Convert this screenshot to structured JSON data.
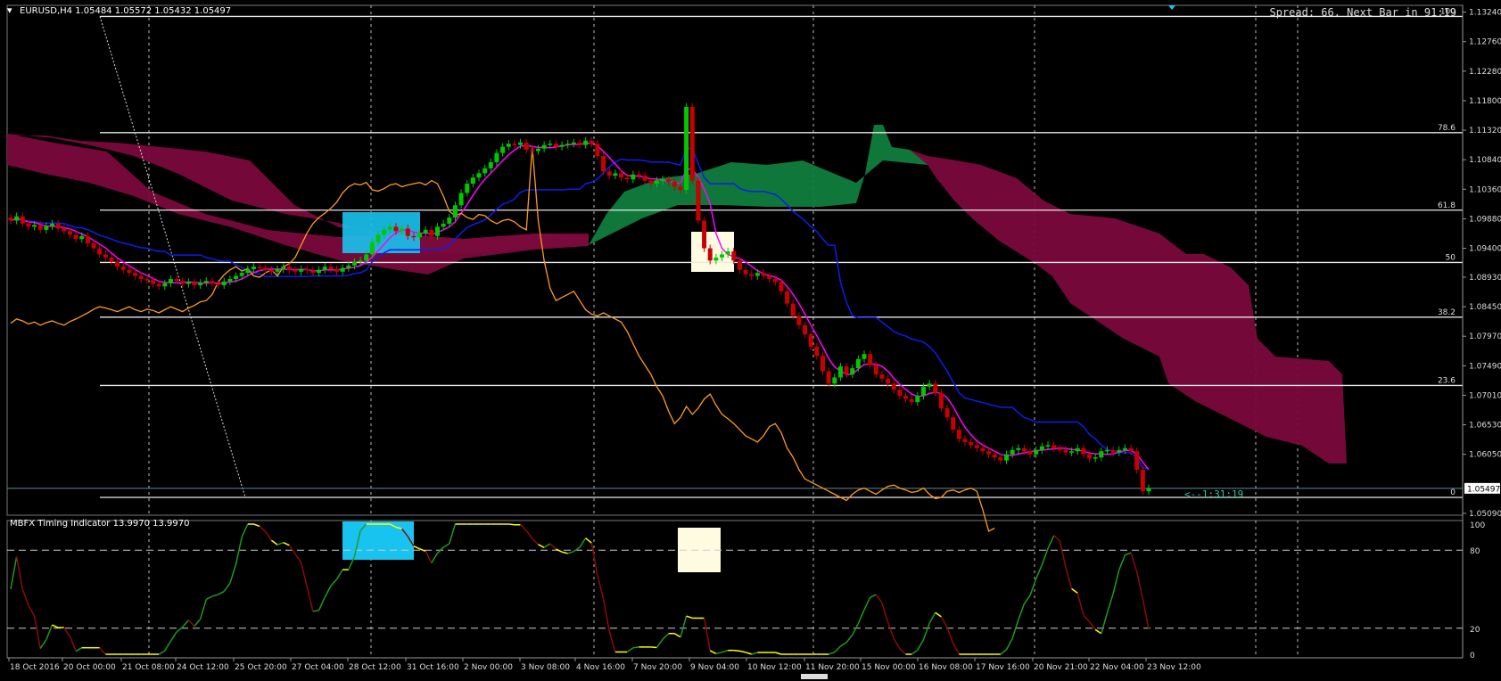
{
  "header": {
    "symbol_line": "EURUSD,H4  1.05484 1.05572 1.05432 1.05497",
    "spread_text": "Spread: 66. Next Bar in 91:19"
  },
  "indicator": {
    "title": "MBFX Timing Indicator 13.9970 13.9970",
    "levels": [
      "100",
      "80",
      "20",
      "0"
    ]
  },
  "countdown": "<--1:31:19",
  "colors": {
    "background": "#000000",
    "bull_candle": "#00c800",
    "bear_candle": "#c80000",
    "blue_line": "#0a1ef0",
    "magenta_line": "#ff00ff",
    "orange_line": "#ff9a1e",
    "cloud_bear": "#7a0a3c",
    "cloud_bull": "#0f7d3c",
    "cyan_box": "#19c3f0",
    "cream_box": "#fffbe1",
    "bid_line": "#5a8c96"
  },
  "chart_data": {
    "type": "candlestick",
    "symbol": "EURUSD",
    "timeframe": "H4",
    "ohlc_last": {
      "open": 1.05484,
      "high": 1.05572,
      "low": 1.05432,
      "close": 1.05497
    },
    "current_price": "1.05497",
    "y_tick_labels": [
      "1.13240",
      "1.12760",
      "1.12280",
      "1.11800",
      "1.11320",
      "1.10840",
      "1.10360",
      "1.09880",
      "1.09400",
      "1.08930",
      "1.08450",
      "1.07970",
      "1.07490",
      "1.07010",
      "1.06530",
      "1.06050",
      "1.05090"
    ],
    "y_tick_values": [
      1.1324,
      1.1276,
      1.1228,
      1.118,
      1.1132,
      1.1084,
      1.1036,
      1.0988,
      1.094,
      1.0893,
      1.0845,
      1.0797,
      1.0749,
      1.0701,
      1.0653,
      1.0605,
      1.0509
    ],
    "ylim": [
      1.0506,
      1.1335
    ],
    "x_tick_labels": [
      "18 Oct 2016",
      "20 Oct 00:00",
      "21 Oct 08:00",
      "24 Oct 12:00",
      "25 Oct 20:00",
      "27 Oct 04:00",
      "28 Oct 12:00",
      "31 Oct 16:00",
      "2 Nov 00:00",
      "3 Nov 08:00",
      "4 Nov 16:00",
      "7 Nov 20:00",
      "9 Nov 04:00",
      "10 Nov 12:00",
      "11 Nov 20:00",
      "15 Nov 00:00",
      "16 Nov 08:00",
      "17 Nov 16:00",
      "20 Nov 21:00",
      "22 Nov 04:00",
      "23 Nov 12:00"
    ],
    "fib_levels": [
      {
        "label": "100",
        "price": 1.1317
      },
      {
        "label": "78.6",
        "price": 1.1128
      },
      {
        "label": "61.8",
        "price": 1.1002
      },
      {
        "label": "50",
        "price": 1.0917
      },
      {
        "label": "38.2",
        "price": 1.0828
      },
      {
        "label": "23.6",
        "price": 1.0717
      },
      {
        "label": "0",
        "price": 1.0535
      }
    ],
    "candles_close": [
      1.0985,
      1.0992,
      1.098,
      1.0975,
      1.0978,
      1.097,
      1.0976,
      1.098,
      1.0972,
      1.0968,
      1.0962,
      1.0955,
      1.096,
      1.0948,
      1.094,
      1.093,
      1.0925,
      1.0918,
      1.091,
      1.0905,
      1.09,
      1.0895,
      1.089,
      1.0888,
      1.0882,
      1.0878,
      1.0883,
      1.089,
      1.0887,
      1.0882,
      1.0885,
      1.088,
      1.0884,
      1.0887,
      1.0883,
      1.088,
      1.0886,
      1.089,
      1.0895,
      1.09,
      1.0906,
      1.091,
      1.0908,
      1.0905,
      1.0902,
      1.0906,
      1.091,
      1.0905,
      1.0902,
      1.0906,
      1.0904,
      1.09,
      1.0905,
      1.091,
      1.0906,
      1.0902,
      1.0908,
      1.0912,
      1.0918,
      1.092,
      1.093,
      1.095,
      1.0962,
      1.097,
      1.0975,
      1.0968,
      1.0972,
      1.096,
      1.0958,
      1.0965,
      1.097,
      1.096,
      1.0975,
      1.098,
      1.099,
      1.101,
      1.103,
      1.1045,
      1.1055,
      1.1062,
      1.107,
      1.108,
      1.1095,
      1.1105,
      1.111,
      1.1108,
      1.1112,
      1.11,
      1.1098,
      1.1102,
      1.1108,
      1.111,
      1.1105,
      1.1108,
      1.111,
      1.1112,
      1.1108,
      1.1115,
      1.111,
      1.109,
      1.1065,
      1.1058,
      1.1062,
      1.1055,
      1.1052,
      1.106,
      1.1058,
      1.105,
      1.1045,
      1.105,
      1.1052,
      1.1048,
      1.104,
      1.1035,
      1.117,
      1.105,
      1.0985,
      1.094,
      1.092,
      1.0925,
      1.093,
      1.0935,
      1.092,
      1.0905,
      1.0898,
      1.0895,
      1.09,
      1.0895,
      1.089,
      1.0885,
      1.087,
      1.085,
      1.083,
      1.0815,
      1.08,
      1.078,
      1.0765,
      1.074,
      1.072,
      1.073,
      1.0748,
      1.0735,
      1.0745,
      1.076,
      1.0768,
      1.075,
      1.0735,
      1.0728,
      1.072,
      1.071,
      1.07,
      1.0695,
      1.069,
      1.07,
      1.0715,
      1.072,
      1.0705,
      1.068,
      1.0665,
      1.0645,
      1.063,
      1.0625,
      1.062,
      1.0615,
      1.061,
      1.0605,
      1.06,
      1.0595,
      1.0605,
      1.0612,
      1.0615,
      1.061,
      1.0605,
      1.0612,
      1.0618,
      1.062,
      1.0615,
      1.0612,
      1.0608,
      1.061,
      1.0615,
      1.0605,
      1.0598,
      1.06,
      1.061,
      1.0612,
      1.0608,
      1.0612,
      1.0615,
      1.061,
      1.058,
      1.0545,
      1.055
    ]
  }
}
